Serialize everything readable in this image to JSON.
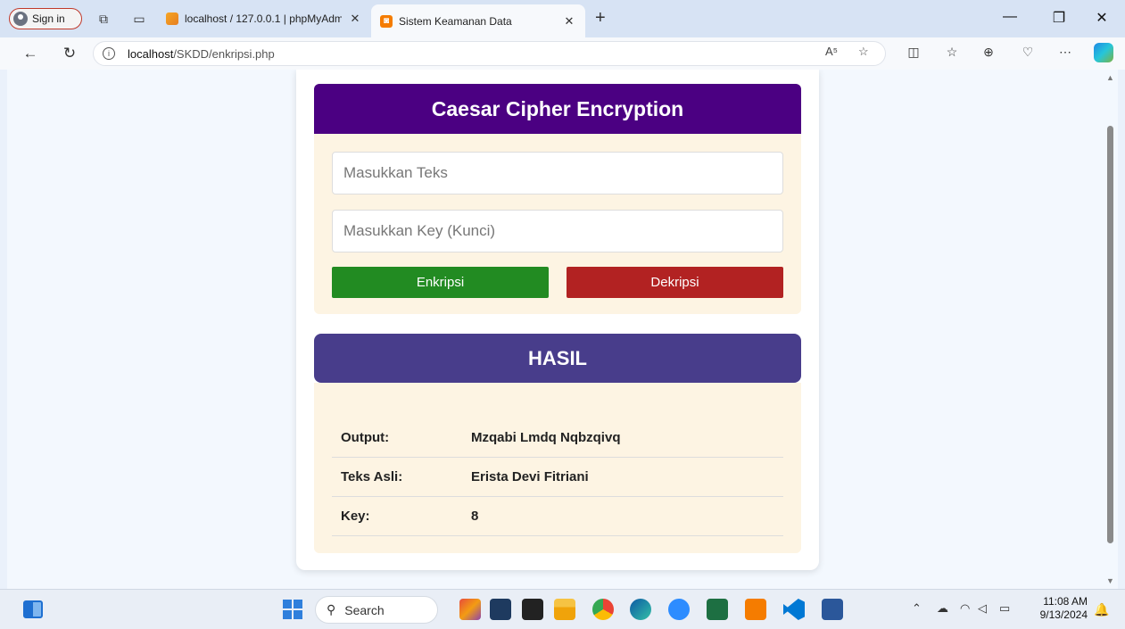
{
  "browser": {
    "signin_label": "Sign in",
    "tabs": [
      {
        "title": "localhost / 127.0.0.1 | phpMyAdm",
        "favicon": "phpmyadmin-icon",
        "active": false
      },
      {
        "title": "Sistem Keamanan Data",
        "favicon": "xampp-icon",
        "active": true
      }
    ],
    "new_tab_glyph": "+",
    "close_glyph": "✕",
    "url_host": "localhost",
    "url_path": "/SKDD/enkripsi.php",
    "read_aloud_glyph": "A⁵"
  },
  "form": {
    "title": "Caesar Cipher Encryption",
    "text_placeholder": "Masukkan Teks",
    "key_placeholder": "Masukkan Key (Kunci)",
    "encrypt_label": "Enkripsi",
    "decrypt_label": "Dekripsi"
  },
  "result": {
    "title": "HASIL",
    "rows": [
      {
        "label": "Output:",
        "value": "Mzqabi Lmdq Nqbzqivq"
      },
      {
        "label": "Teks Asli:",
        "value": "Erista Devi Fitriani"
      },
      {
        "label": "Key:",
        "value": "8"
      }
    ]
  },
  "taskbar": {
    "search_label": "Search",
    "time": "11:08 AM",
    "date": "9/13/2024"
  },
  "colors": {
    "form_header": "#4b0082",
    "result_header": "#483d8b",
    "encrypt": "#228b22",
    "decrypt": "#b22222",
    "panel_bg": "#fdf4e3"
  }
}
